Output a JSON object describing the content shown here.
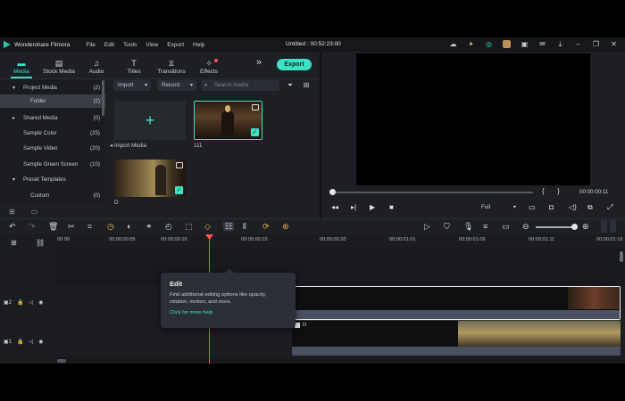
{
  "app": {
    "name": "Wondershare Filmora",
    "project_title": "Untitled : 00:52:23:00"
  },
  "menu": [
    "File",
    "Edit",
    "Tools",
    "View",
    "Export",
    "Help"
  ],
  "tabs": [
    {
      "label": "Media",
      "icon": "folder-icon"
    },
    {
      "label": "Stock Media",
      "icon": "stock-media-icon"
    },
    {
      "label": "Audio",
      "icon": "music-note-icon"
    },
    {
      "label": "Titles",
      "icon": "titles-icon"
    },
    {
      "label": "Transitions",
      "icon": "transitions-icon"
    },
    {
      "label": "Effects",
      "icon": "effects-icon"
    }
  ],
  "export_label": "Export",
  "tree": [
    {
      "label": "Project Media",
      "count": "(2)",
      "caret": "▾"
    },
    {
      "label": "Folder",
      "count": "(2)",
      "caret": ""
    },
    {
      "label": "Shared Media",
      "count": "(0)",
      "caret": "▸"
    },
    {
      "label": "Sample Color",
      "count": "(25)",
      "caret": ""
    },
    {
      "label": "Sample Video",
      "count": "(20)",
      "caret": ""
    },
    {
      "label": "Sample Green Screen",
      "count": "(10)",
      "caret": ""
    },
    {
      "label": "Preset Templates",
      "count": "",
      "caret": "▾"
    },
    {
      "label": "Custom",
      "count": "(0)",
      "caret": ""
    }
  ],
  "media_toolbar": {
    "import_label": "Import",
    "record_label": "Record",
    "search_placeholder": "Search media"
  },
  "media_items": {
    "import_label": "Import Media",
    "clip1_name": "111",
    "clip2_name": "D"
  },
  "preview": {
    "timecode": "00:00:00:11",
    "quality": "Full",
    "bracket_in": "{",
    "bracket_out": "}"
  },
  "ruler": [
    "00:00",
    "00:00:00:05",
    "00:00:00:10",
    "00:00:00:15",
    "00:00:00:20",
    "00:00:01:01",
    "00:00:01:06",
    "00:00:01:11",
    "00:00:01:16"
  ],
  "tooltip": {
    "title": "Edit",
    "description": "Find additional editing options like opacity, rotation, motion, and more.",
    "link": "Click for more help"
  },
  "timeline_clips": {
    "track1_label": "111",
    "track2_label": "D"
  },
  "colors": {
    "accent": "#3fe0c4",
    "playhead": "#ff5a4d",
    "keyframe": "#e6b84a"
  }
}
